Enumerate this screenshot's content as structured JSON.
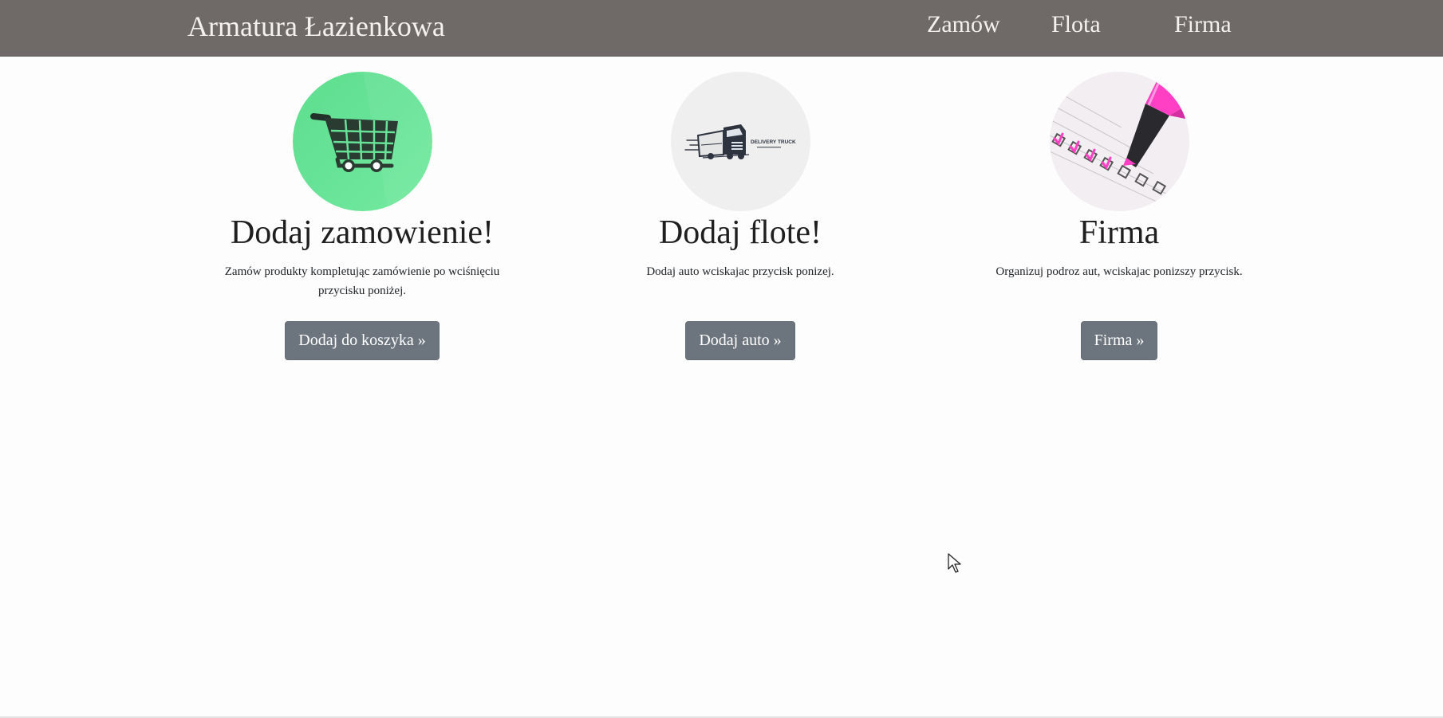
{
  "navbar": {
    "brand": "Armatura Łazienkowa",
    "links": [
      "Zamów",
      "Flota",
      "Firma"
    ]
  },
  "cards": [
    {
      "image_icon": "shopping-cart-icon",
      "title": "Dodaj zamowienie!",
      "text": "Zamów produkty kompletując zamówienie po wciśnięciu przycisku poniżej.",
      "button": "Dodaj do koszyka »"
    },
    {
      "image_icon": "delivery-truck-icon",
      "image_caption": "DELIVERY TRUCK",
      "title": "Dodaj flote!",
      "text": "Dodaj auto wciskajac przycisk ponizej.",
      "button": "Dodaj auto »"
    },
    {
      "image_icon": "checklist-highlighter-icon",
      "title": "Firma",
      "text": "Organizuj podroz aut, wciskajac ponizszy przycisk.",
      "button": "Firma »"
    }
  ],
  "colors": {
    "navbar_bg": "#6f6a67",
    "button_bg": "#6c757d",
    "cart_circle_bg": "#67e397",
    "truck_circle_bg": "#efefef",
    "highlighter_pink": "#ff3fc4"
  }
}
